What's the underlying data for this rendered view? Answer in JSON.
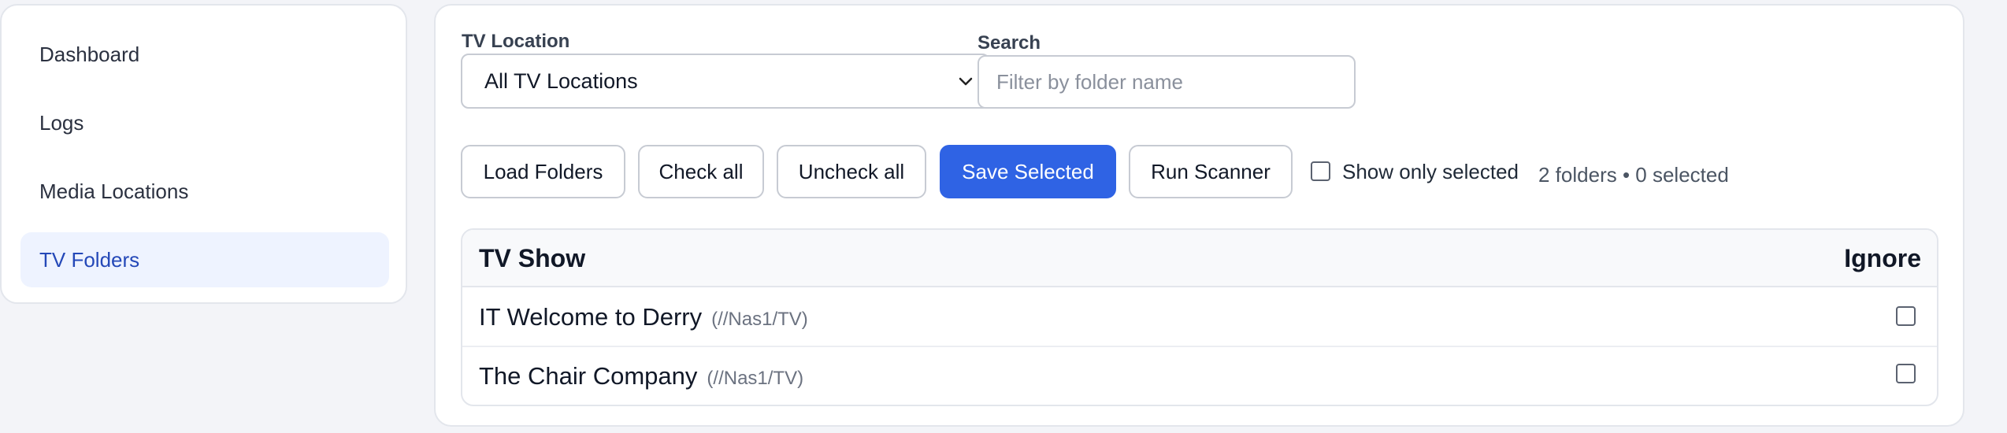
{
  "sidebar": {
    "items": [
      {
        "label": "Dashboard",
        "active": false
      },
      {
        "label": "Logs",
        "active": false
      },
      {
        "label": "Media Locations",
        "active": false
      },
      {
        "label": "TV Folders",
        "active": true
      }
    ]
  },
  "filters": {
    "location_label": "TV Location",
    "location_value": "All TV Locations",
    "search_label": "Search",
    "search_placeholder": "Filter by folder name",
    "search_value": ""
  },
  "toolbar": {
    "load_label": "Load Folders",
    "check_all_label": "Check all",
    "uncheck_all_label": "Uncheck all",
    "save_label": "Save Selected",
    "run_label": "Run Scanner",
    "show_only_label": "Show only selected",
    "show_only_checked": false,
    "summary": "2 folders • 0 selected"
  },
  "table": {
    "headers": {
      "show": "TV Show",
      "ignore": "Ignore"
    },
    "rows": [
      {
        "title": "IT Welcome to Derry",
        "path": "(//Nas1/TV)",
        "ignore": false
      },
      {
        "title": "The Chair Company",
        "path": "(//Nas1/TV)",
        "ignore": false
      }
    ]
  },
  "colors": {
    "primary": "#2f63e4",
    "active_nav_bg": "#eef3ff",
    "active_nav_text": "#2448b8",
    "page_bg": "#f3f4f8"
  }
}
